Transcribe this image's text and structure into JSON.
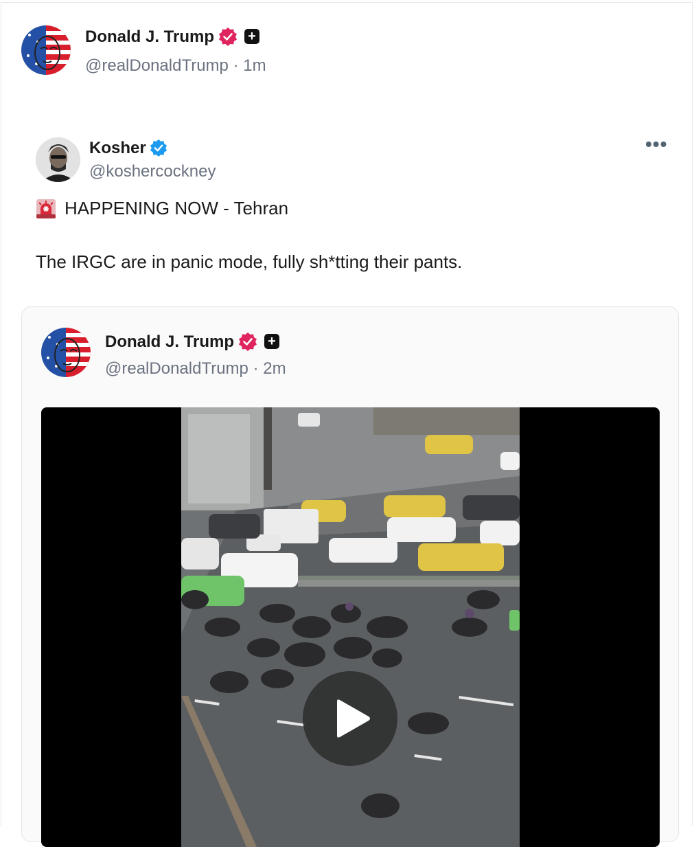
{
  "post": {
    "author": {
      "name": "Donald J. Trump",
      "handle": "@realDonaldTrump",
      "time": "1m",
      "verified_icon": "verified-badge-pink",
      "plus_icon": "plus-badge"
    }
  },
  "quoted": {
    "author": {
      "name": "Kosher",
      "handle": "@koshercockney",
      "verified_icon": "verified-badge-blue"
    },
    "more_label": "•••",
    "alert_icon": "rotating-light-emoji",
    "headline": "HAPPENING NOW - Tehran",
    "text": "The IRGC are in panic mode, fully sh*tting their pants.",
    "nested": {
      "author": {
        "name": "Donald J. Trump",
        "handle": "@realDonaldTrump",
        "time": "2m"
      },
      "media": {
        "type": "video",
        "play_icon": "play-icon"
      }
    }
  },
  "colors": {
    "pink_badge": "#e0245e",
    "blue_badge": "#1d9bf0",
    "handle_gray": "#6b7280"
  }
}
